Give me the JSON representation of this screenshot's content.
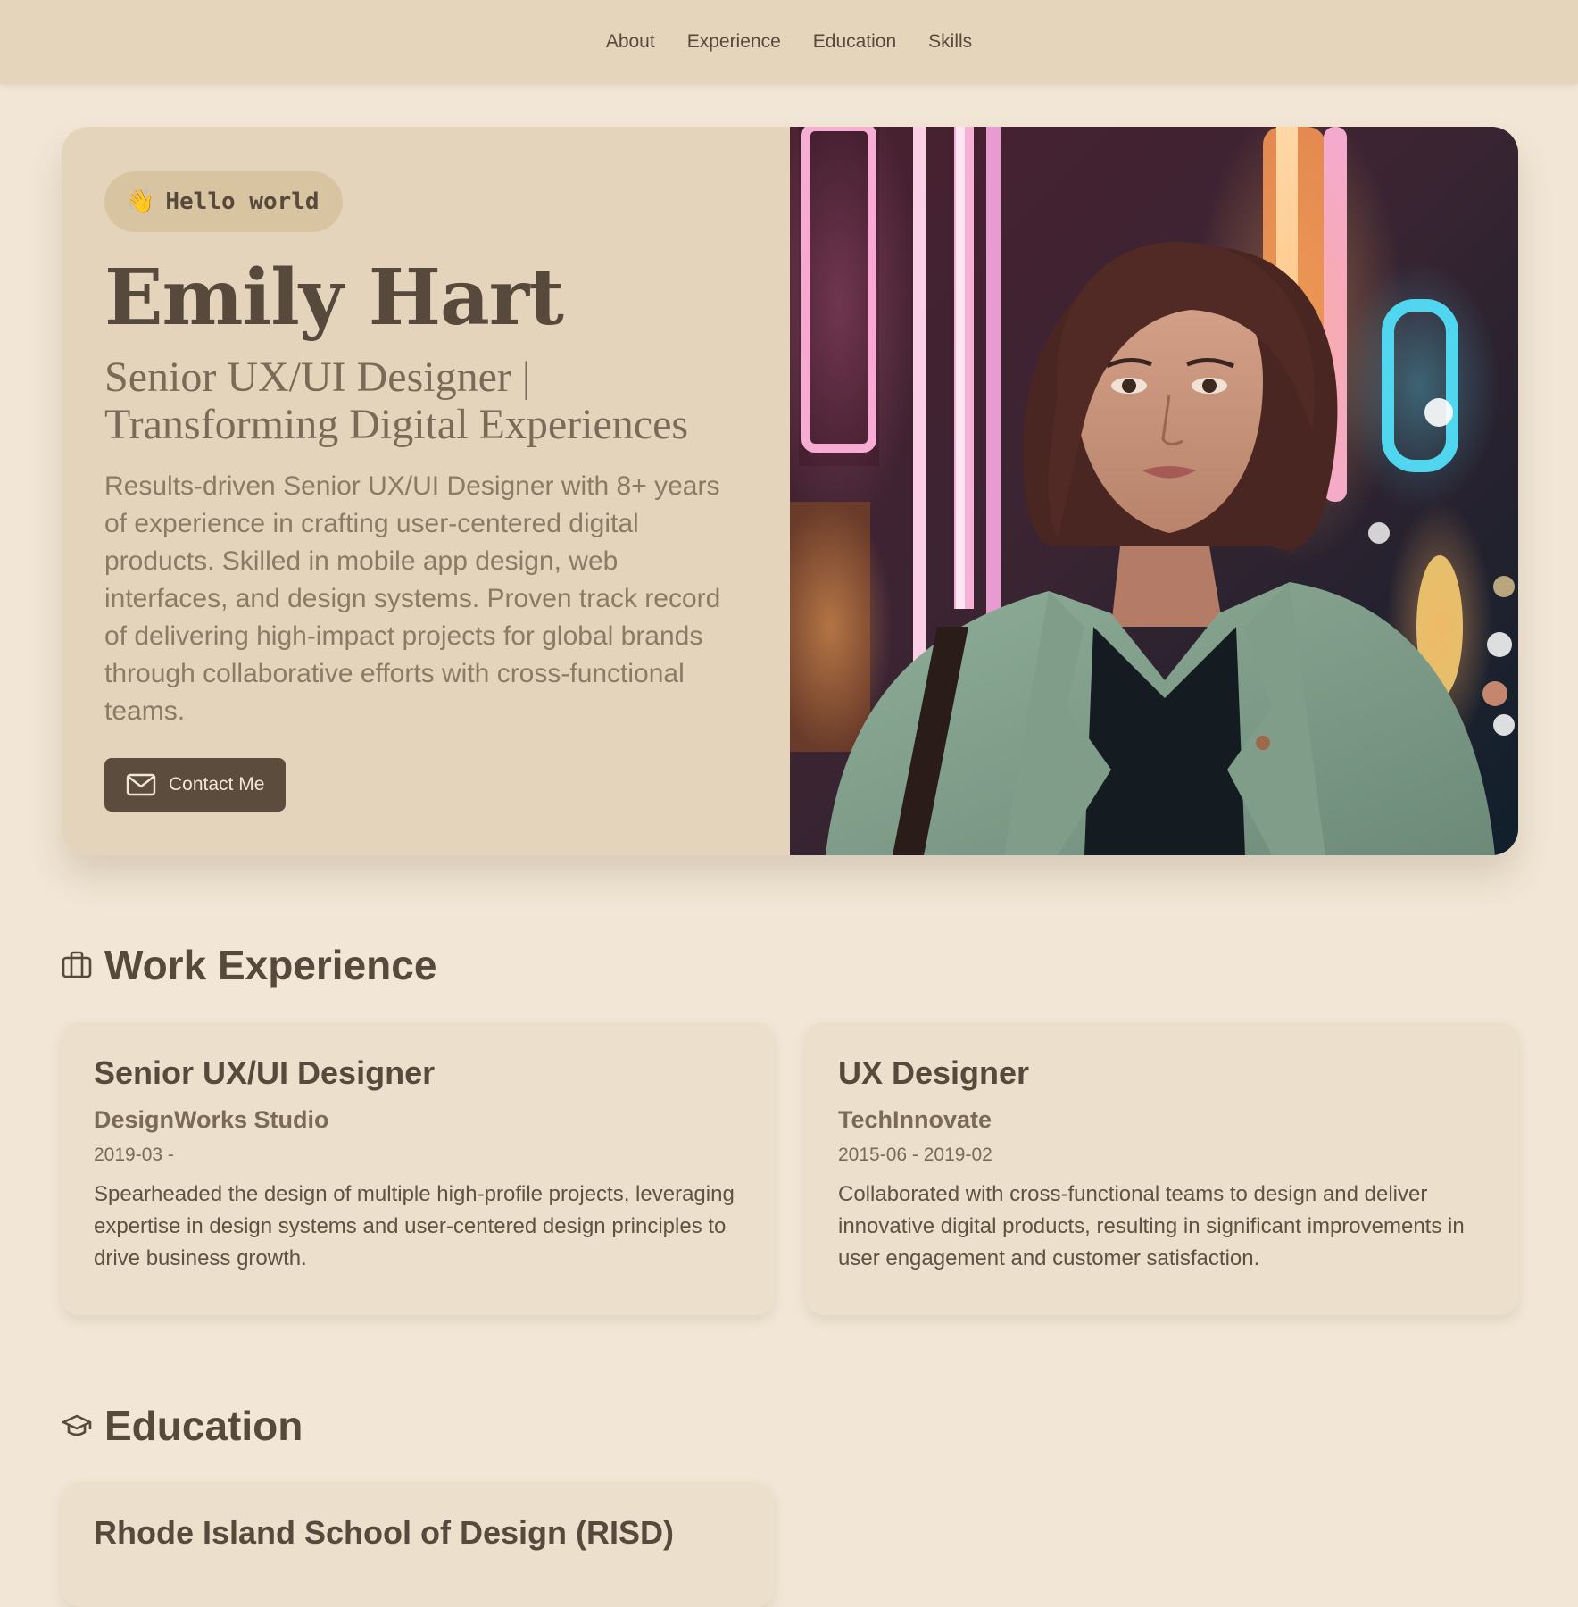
{
  "nav": {
    "items": [
      {
        "label": "About"
      },
      {
        "label": "Experience"
      },
      {
        "label": "Education"
      },
      {
        "label": "Skills"
      }
    ]
  },
  "hero": {
    "badge_emoji": "👋",
    "badge_text": "Hello world",
    "name": "Emily Hart",
    "tagline_line1": "Senior UX/UI Designer |",
    "tagline_line2": "Transforming Digital Experiences",
    "summary": "Results-driven Senior UX/UI Designer with 8+ years of experience in crafting user-centered digital products. Skilled in mobile app design, web interfaces, and design systems. Proven track record of delivering high-impact projects for global brands through collaborative efforts with cross-functional teams.",
    "contact_label": "Contact Me",
    "contact_icon": "mail-icon"
  },
  "work": {
    "title": "Work Experience",
    "icon": "briefcase-icon",
    "jobs": [
      {
        "role": "Senior UX/UI Designer",
        "company": "DesignWorks Studio",
        "dates": "2019-03 -",
        "description": "Spearheaded the design of multiple high-profile projects, leveraging expertise in design systems and user-centered design principles to drive business growth."
      },
      {
        "role": "UX Designer",
        "company": "TechInnovate",
        "dates": "2015-06 - 2019-02",
        "description": "Collaborated with cross-functional teams to design and deliver innovative digital products, resulting in significant improvements in user engagement and customer satisfaction."
      }
    ]
  },
  "education": {
    "title": "Education",
    "icon": "graduation-cap-icon",
    "schools": [
      {
        "name": "Rhode Island School of Design (RISD)"
      }
    ]
  },
  "colors": {
    "background": "#f2e6d6",
    "nav": "#e4d5bb",
    "card": "#ecdfcb",
    "text": "#574a3d",
    "button": "#5b4c3e"
  }
}
